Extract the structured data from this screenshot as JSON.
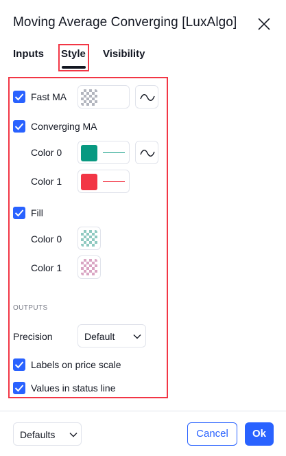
{
  "dialog": {
    "title": "Moving Average Converging [LuxAlgo]",
    "close_icon": "close-icon"
  },
  "tabs": [
    {
      "label": "Inputs",
      "active": false
    },
    {
      "label": "Style",
      "active": true
    },
    {
      "label": "Visibility",
      "active": false
    }
  ],
  "style": {
    "fast_ma": {
      "label": "Fast MA",
      "checked": true,
      "color": "transparent-gray"
    },
    "converging_ma": {
      "label": "Converging MA",
      "checked": true,
      "color0": {
        "label": "Color 0",
        "color": "#089981"
      },
      "color1": {
        "label": "Color 1",
        "color": "#f23645"
      }
    },
    "fill": {
      "label": "Fill",
      "checked": true,
      "color0": {
        "label": "Color 0",
        "color": "transparent-teal"
      },
      "color1": {
        "label": "Color 1",
        "color": "transparent-pink"
      }
    },
    "outputs": {
      "header": "OUTPUTS",
      "precision_label": "Precision",
      "precision_value": "Default",
      "labels_on_price_scale": {
        "label": "Labels on price scale",
        "checked": true
      },
      "values_in_status_line": {
        "label": "Values in status line",
        "checked": true
      }
    }
  },
  "footer": {
    "defaults_label": "Defaults",
    "cancel_label": "Cancel",
    "ok_label": "Ok"
  },
  "colors": {
    "accent": "#2962ff",
    "highlight": "#f23645",
    "text": "#131722"
  }
}
